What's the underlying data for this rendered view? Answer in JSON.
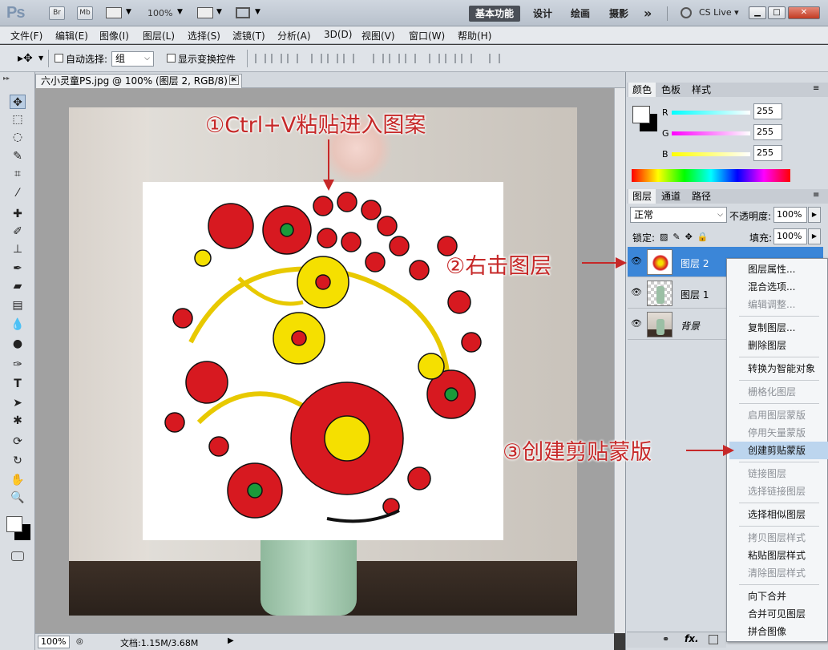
{
  "titlebar": {
    "logo": "Ps",
    "btn_br": "Br",
    "btn_mb": "Mb",
    "zoom": "100%",
    "workspaces": [
      "基本功能",
      "设计",
      "绘画",
      "摄影"
    ],
    "more": "»",
    "cs_live": "CS Live ▾",
    "min": "▁",
    "restore": "□",
    "close": "✕"
  },
  "menu": [
    "文件(F)",
    "编辑(E)",
    "图像(I)",
    "图层(L)",
    "选择(S)",
    "滤镜(T)",
    "分析(A)",
    "3D(D)",
    "视图(V)",
    "窗口(W)",
    "帮助(H)"
  ],
  "options": {
    "auto_select_label": "自动选择:",
    "auto_select_value": "组",
    "show_transform_label": "显示变换控件"
  },
  "document": {
    "tab_title": "六小灵童PS.jpg @ 100% (图层 2, RGB/8) *",
    "zoom": "100%",
    "doc_info": "文档:1.15M/3.68M"
  },
  "color_panel": {
    "tabs": [
      "颜色",
      "色板",
      "样式"
    ],
    "r_label": "R",
    "g_label": "G",
    "b_label": "B",
    "r": "255",
    "g": "255",
    "b": "255"
  },
  "layers_panel": {
    "tabs": [
      "图层",
      "通道",
      "路径"
    ],
    "blend_mode": "正常",
    "opacity_label": "不透明度:",
    "opacity": "100%",
    "lock_label": "锁定:",
    "fill_label": "填充:",
    "fill": "100%",
    "layers": [
      {
        "name": "图层 2",
        "selected": true
      },
      {
        "name": "图层 1",
        "selected": false
      },
      {
        "name": "背景",
        "selected": false
      }
    ]
  },
  "context_menu": [
    {
      "label": "图层属性...",
      "disabled": false
    },
    {
      "label": "混合选项...",
      "disabled": false
    },
    {
      "label": "编辑调整...",
      "disabled": true
    },
    {
      "label": "复制图层...",
      "disabled": false
    },
    {
      "label": "删除图层",
      "disabled": false
    },
    {
      "label": "转换为智能对象",
      "disabled": false
    },
    {
      "label": "栅格化图层",
      "disabled": true
    },
    {
      "label": "启用图层蒙版",
      "disabled": true
    },
    {
      "label": "停用矢量蒙版",
      "disabled": true
    },
    {
      "label": "创建剪贴蒙版",
      "disabled": false,
      "highlight": true
    },
    {
      "label": "链接图层",
      "disabled": true
    },
    {
      "label": "选择链接图层",
      "disabled": true
    },
    {
      "label": "选择相似图层",
      "disabled": false
    },
    {
      "label": "拷贝图层样式",
      "disabled": true
    },
    {
      "label": "粘贴图层样式",
      "disabled": false
    },
    {
      "label": "清除图层样式",
      "disabled": true
    },
    {
      "label": "向下合并",
      "disabled": false
    },
    {
      "label": "合并可见图层",
      "disabled": false
    },
    {
      "label": "拼合图像",
      "disabled": false
    }
  ],
  "annotations": {
    "step1": "①Ctrl+V粘贴进入图案",
    "step2": "②右击图层",
    "step3": "③创建剪贴蒙版"
  },
  "colors": {
    "accent_red": "#c62828",
    "selected_layer": "#3b86d8",
    "menu_highlight": "#bcd5ee"
  }
}
